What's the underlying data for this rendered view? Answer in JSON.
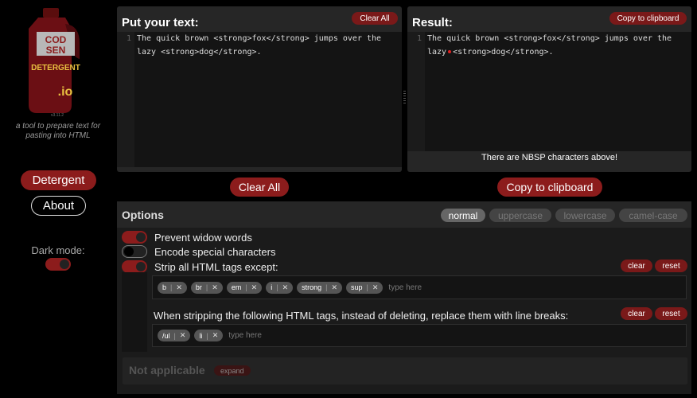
{
  "sidebar": {
    "logo": {
      "line1": "COD",
      "line2": "SEN",
      "line3": "DETERGENT",
      "line4": ".io",
      "version": "v3.11.2"
    },
    "tagline": "a tool to prepare text for pasting into HTML",
    "nav": {
      "detergent": "Detergent",
      "about": "About"
    },
    "dark_mode_label": "Dark mode:",
    "dark_mode_on": true
  },
  "input_panel": {
    "title": "Put your text:",
    "clear_label": "Clear All",
    "line_number": "1",
    "text": "The quick brown <strong>fox</strong> jumps over the lazy <strong>dog</strong>."
  },
  "result_panel": {
    "title": "Result:",
    "copy_label": "Copy to clipboard",
    "line_number": "1",
    "text_before_nbsp": "The quick brown <strong>fox</strong> jumps over the lazy",
    "text_after_nbsp": "<strong>dog</strong>.",
    "nbsp_notice": "There are NBSP characters above!"
  },
  "actions": {
    "clear_all": "Clear All",
    "copy_to_clipboard": "Copy to clipboard"
  },
  "options": {
    "title": "Options",
    "case_modes": [
      "normal",
      "uppercase",
      "lowercase",
      "camel-case"
    ],
    "case_active": "normal",
    "prevent_widow": {
      "label": "Prevent widow words",
      "on": true
    },
    "encode_special": {
      "label": "Encode special characters",
      "on": false
    },
    "strip_html": {
      "label": "Strip all HTML tags except:",
      "on": true,
      "clear_label": "clear",
      "reset_label": "reset",
      "tags": [
        "b",
        "br",
        "em",
        "i",
        "strong",
        "sup"
      ],
      "placeholder": "type here"
    },
    "replace_linebreaks": {
      "label": "When stripping the following HTML tags, instead of deleting, replace them with line breaks:",
      "clear_label": "clear",
      "reset_label": "reset",
      "tags": [
        "/ul",
        "li"
      ],
      "placeholder": "type here"
    },
    "not_applicable": {
      "title": "Not applicable",
      "expand_label": "expand"
    }
  },
  "colors": {
    "accent": "#8c1c1c",
    "pill": "#7a1919",
    "panel": "#262626",
    "editor": "#141414"
  }
}
